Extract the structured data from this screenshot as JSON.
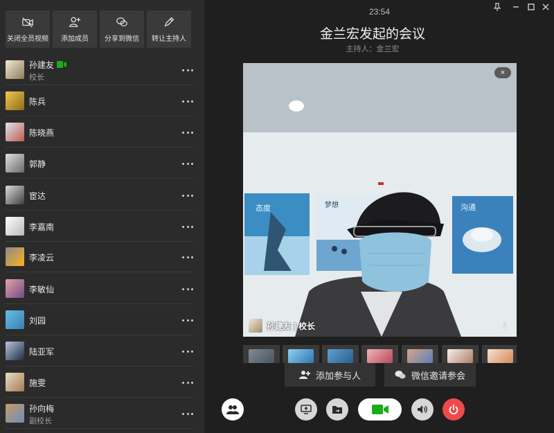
{
  "toolbar": {
    "buttons": [
      {
        "label": "关闭全员视频",
        "icon": "camera-off-icon"
      },
      {
        "label": "添加成员",
        "icon": "add-person-icon"
      },
      {
        "label": "分享到微信",
        "icon": "wechat-icon"
      },
      {
        "label": "转让主持人",
        "icon": "transfer-pen-icon"
      }
    ]
  },
  "members": [
    {
      "name": "孙建友",
      "role": "校长",
      "camera_on": true
    },
    {
      "name": "陈兵"
    },
    {
      "name": "陈晓燕"
    },
    {
      "name": "郭静"
    },
    {
      "name": "宦达"
    },
    {
      "name": "李嘉南"
    },
    {
      "name": "李凌云"
    },
    {
      "name": "李敏仙"
    },
    {
      "name": "刘园"
    },
    {
      "name": "陆亚军"
    },
    {
      "name": "施雯"
    },
    {
      "name": "孙向梅",
      "role": "副校长"
    }
  ],
  "header": {
    "time": "23:54",
    "title": "金兰宏发起的会议",
    "host": "主持人：金兰宏"
  },
  "video": {
    "speaker_label": "孙建友 | 校长",
    "close_symbol": "×",
    "poster_texts": [
      "态度",
      "梦想",
      "沟通"
    ]
  },
  "actions": {
    "add_participant": "添加参与人",
    "wechat_invite": "微信邀请参会"
  },
  "colors": {
    "accent_green": "#1aad19",
    "hangup_red": "#f0494a",
    "background": "#1f1f1f",
    "panel": "#2b2b2b"
  }
}
